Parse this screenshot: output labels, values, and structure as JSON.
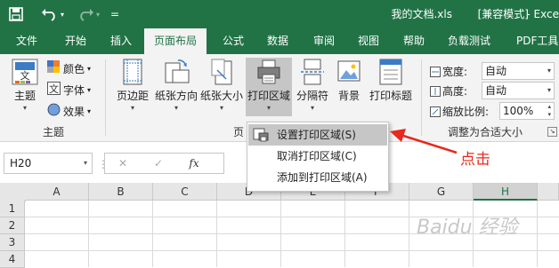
{
  "window": {
    "title": "我的文档.xls",
    "mode": "[兼容模式]",
    "app": "- Exce"
  },
  "qat": {
    "save_icon": "save-icon",
    "undo_icon": "undo-icon",
    "redo_icon": "redo-icon",
    "customize": "="
  },
  "tabs": [
    {
      "label": "文件"
    },
    {
      "label": "开始"
    },
    {
      "label": "插入"
    },
    {
      "label": "页面布局"
    },
    {
      "label": "公式"
    },
    {
      "label": "数据"
    },
    {
      "label": "审阅"
    },
    {
      "label": "视图"
    },
    {
      "label": "帮助"
    },
    {
      "label": "负载测试"
    },
    {
      "label": "PDF工具"
    }
  ],
  "active_tab": "页面布局",
  "ribbon": {
    "themes": {
      "theme_label": "主题",
      "colors_label": "颜色",
      "fonts_label": "字体",
      "effects_label": "效果",
      "group_label": "主题"
    },
    "page_setup": {
      "margins": "页边距",
      "orientation": "纸张方向",
      "size": "纸张大小",
      "print_area": "打印区域",
      "breaks": "分隔符",
      "background": "背景",
      "print_titles": "打印标题",
      "group_label_partial": "页"
    },
    "scale": {
      "width_label": "宽度:",
      "width_value": "自动",
      "height_label": "高度:",
      "height_value": "自动",
      "scale_label": "缩放比例:",
      "scale_value": "100%",
      "group_label": "调整为合适大小"
    }
  },
  "formula_bar": {
    "name_box": "H20",
    "cancel": "✕",
    "enter": "✓",
    "fx": "fx"
  },
  "sheet": {
    "columns": [
      "A",
      "B",
      "C",
      "D",
      "E",
      "F",
      "G",
      "H"
    ],
    "selected_column": "H",
    "rows": [
      "1",
      "2",
      "3",
      "4"
    ]
  },
  "dropdown_menu": {
    "items": [
      {
        "label": "设置打印区域(S)",
        "highlighted": true
      },
      {
        "label": "取消打印区域(C)",
        "highlighted": false
      },
      {
        "label": "添加到打印区域(A)",
        "highlighted": false
      }
    ]
  },
  "annotation": {
    "text": "点击",
    "color": "#e8281e"
  },
  "watermark": "Baidu 经验",
  "colors": {
    "excel_green": "#217346",
    "ribbon_bg": "#f3f3f3"
  }
}
